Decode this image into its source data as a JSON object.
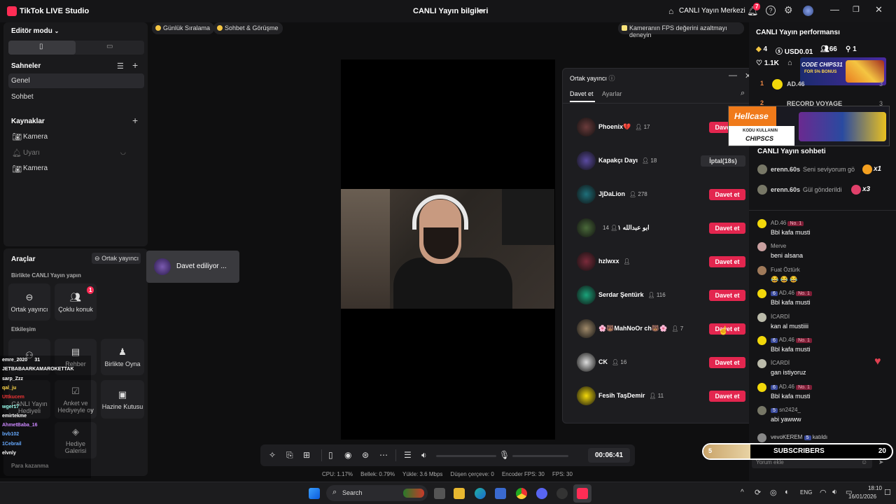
{
  "titlebar": {
    "app_name": "TikTok LIVE Studio",
    "center_title": "CANLI Yayın bilgileri",
    "live_center": "CANLI Yayın Merkezi",
    "notif_count": "7"
  },
  "left": {
    "editor_mode": "Editör modu",
    "scenes_title": "Sahneler",
    "scenes": [
      "Genel",
      "Sohbet"
    ],
    "sources_title": "Kaynaklar",
    "sources": [
      "Kamera",
      "Uyarı",
      "Kamera"
    ],
    "tools_title": "Araçlar",
    "cohost_link": "Ortak yayıncı",
    "live_together": "Birlikte CANLI Yayın yapın",
    "tool_cohost": "Ortak yayıncı",
    "tool_multi": "Çoklu konuk",
    "multi_badge": "1",
    "interaction": "Etkileşim",
    "tool_guide": "Rehber",
    "tool_play": "Birlikte Oyna",
    "tool_poll": "Anket ve Hediyeyle oy",
    "tool_treasure": "Hazine Kutusu",
    "tool_gallery": "Hediye Galerisi",
    "tool_partial_live": "CANLI Yayın",
    "tool_partial_gift": "Hediyeli",
    "earn": "Para kazanma",
    "inviting_toast": "Davet ediliyor ..."
  },
  "overlay_chat": [
    {
      "user": "emre_2020",
      "msg": "31",
      "color": "#ffffff"
    },
    {
      "user": "JETBABAARKAMAROKETTAK",
      "msg": "",
      "color": "#ffffff"
    },
    {
      "user": "sarp_Zzz",
      "msg": "",
      "color": "#ffffff"
    },
    {
      "user": "qal_ju",
      "msg": "",
      "color": "#ffd84a"
    },
    {
      "user": "Uttkucem",
      "msg": "",
      "color": "#e33"
    },
    {
      "user": "wger17",
      "msg": "",
      "color": "#9fe"
    },
    {
      "user": "emirtekme",
      "msg": "",
      "color": "#ffffff"
    },
    {
      "user": "AhmetBaba_16",
      "msg": "",
      "color": "#c8f"
    },
    {
      "user": "bvb102",
      "msg": "",
      "color": "#6af"
    },
    {
      "user": "1Cebrail",
      "msg": "",
      "color": "#6af"
    },
    {
      "user": "elvnly",
      "msg": "",
      "color": "#ffffff"
    }
  ],
  "pills": [
    "Günlük Sıralama",
    "Sohbet & Görüşme"
  ],
  "fps_tip": "Kameranın FPS değerini azaltmayı deneyin",
  "invite": {
    "title": "Ortak yayıncı",
    "tab_invite": "Davet et",
    "tab_settings": "Ayarlar",
    "rows": [
      {
        "name": "Phoenix💔",
        "count": "17",
        "button": "Davet et",
        "color": "#6b3b3b",
        "cancel": false
      },
      {
        "name": "Kapakçı Dayı",
        "count": "18",
        "button": "İptal(18s)",
        "color": "#5a4aa0",
        "cancel": true
      },
      {
        "name": "JjDaLion",
        "count": "278",
        "button": "Davet et",
        "color": "#1e6f7a",
        "cancel": false
      },
      {
        "name": "ابو عبدالله ١",
        "count": "14",
        "button": "Davet et",
        "color": "#4a6a3a",
        "cancel": false
      },
      {
        "name": "hzlwxx",
        "count": "",
        "button": "Davet et",
        "color": "#7a2a3a",
        "cancel": false
      },
      {
        "name": "Serdar Şentürk",
        "count": "116",
        "button": "Davet et",
        "color": "#1aa37a",
        "cancel": false
      },
      {
        "name": "🌸🐻MahNoOr ch🐻🌸",
        "count": "7",
        "button": "Davet et",
        "color": "#a08a6a",
        "cancel": false
      },
      {
        "name": "CK",
        "count": "16",
        "button": "Davet et",
        "color": "#ddd",
        "cancel": false
      },
      {
        "name": "Fesih TaşDemir",
        "count": "11",
        "button": "Davet et",
        "color": "#f2d80a",
        "cancel": false
      }
    ]
  },
  "right": {
    "perf_title": "CANLI Yayın performansı",
    "diamonds": "4",
    "usd": "USD0.01",
    "viewers": "66",
    "followers": "1",
    "likes": "1.1K",
    "ad1_line1": "CODE CHIPS31",
    "ad1_line2": "FOR 5% BONUS",
    "rank_rows": [
      {
        "rank": "1",
        "name": "AD.46",
        "val": "3"
      },
      {
        "rank": "2",
        "name": "RECORD VOYAGE",
        "val": "3"
      }
    ],
    "ad2_brand": "Hellcase",
    "ad2_text1": "KODU KULLANIN",
    "ad2_text2": "CHIPSCS",
    "chat_title": "CANLI Yayın sohbeti",
    "gift_rows": [
      {
        "user": "erenn.60s",
        "text": "Seni seviyorum gö",
        "mult": "x1"
      },
      {
        "user": "erenn.60s",
        "text": "Gül gönderildi",
        "mult": "x3"
      }
    ],
    "chat": [
      {
        "user": "AD.46",
        "msg": "Bbl kafa musti",
        "lvl": "",
        "no1": "No. 1",
        "av": "#f2d80a"
      },
      {
        "user": "Merve",
        "msg": "beni alsana",
        "lvl": "",
        "no1": "",
        "av": "#c9a0a0"
      },
      {
        "user": "Fuat Öztürk",
        "msg": "😂 😂 😂",
        "lvl": "",
        "no1": "",
        "av": "#a07a5a"
      },
      {
        "user": "AD.46",
        "msg": "Bbl kafa musti",
        "lvl": "6",
        "no1": "No. 1",
        "av": "#f2d80a"
      },
      {
        "user": "İCARDİ",
        "msg": "kan al mustiiii",
        "lvl": "",
        "no1": "",
        "av": "#bba"
      },
      {
        "user": "AD.46",
        "msg": "Bbl kafa musti",
        "lvl": "6",
        "no1": "No. 1",
        "av": "#f2d80a"
      },
      {
        "user": "İCARDİ",
        "msg": "gan istiyoruz",
        "lvl": "",
        "no1": "",
        "av": "#bba"
      },
      {
        "user": "AD.46",
        "msg": "Bbl kafa musti",
        "lvl": "6",
        "no1": "No. 1",
        "av": "#f2d80a"
      },
      {
        "user": "sn2424_",
        "msg": "abi yawww",
        "lvl": "5",
        "no1": "",
        "av": "#776"
      }
    ],
    "join_user": "vevoKEREM",
    "join_lvl": "5",
    "join_text": "katıldı",
    "comment_placeholder": "Yorum ekle"
  },
  "subs": {
    "label": "SUBSCRIBERS",
    "left": "5",
    "right": "20",
    "progress": 0.25
  },
  "toolbar": {
    "timer": "00:06:41"
  },
  "status": {
    "cpu": "CPU: 1.17%",
    "mem": "Bellek: 0.79%",
    "upload": "Yükle: 3.6 Mbps",
    "dropped": "Düşen çerçeve: 0",
    "enc_fps": "Encoder FPS: 30",
    "fps": "FPS: 30"
  },
  "taskbar": {
    "search": "Search",
    "lang": "ENG",
    "time": "18:10",
    "date": "16/01/2026"
  }
}
